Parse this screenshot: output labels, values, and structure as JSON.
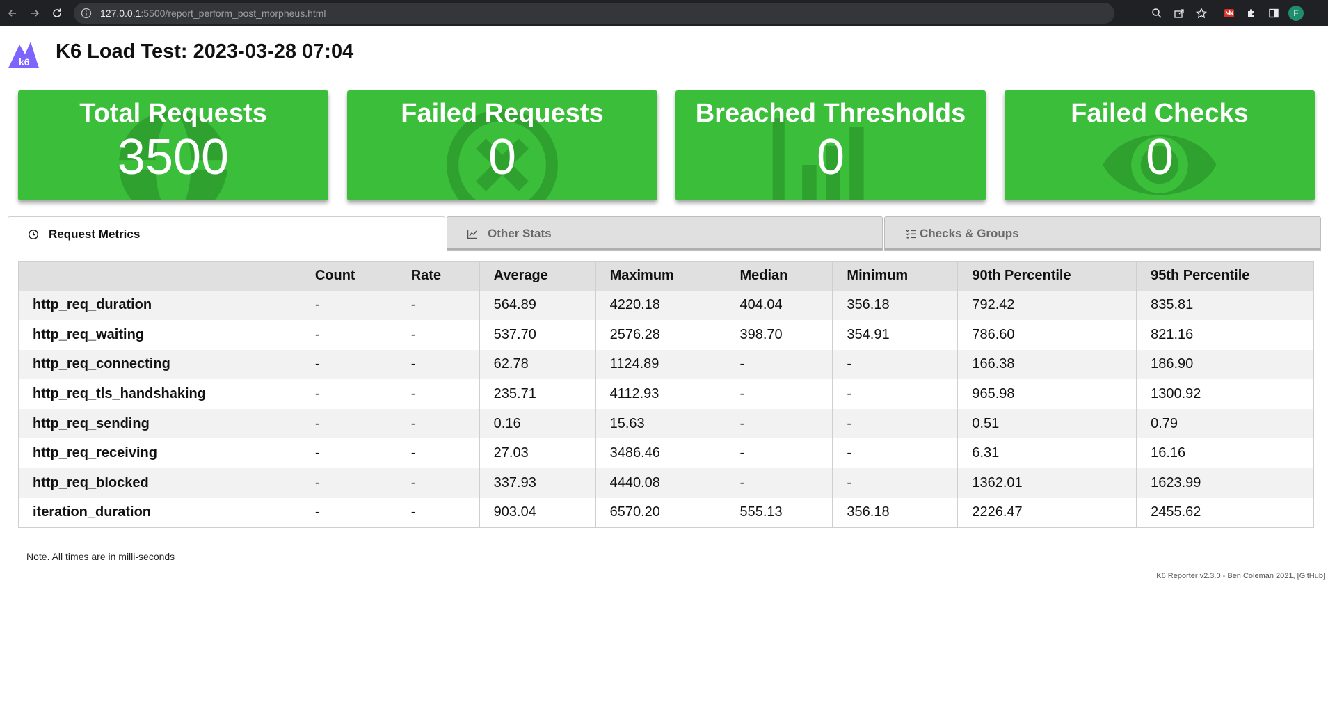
{
  "browser": {
    "url_host": "127.0.0.1",
    "url_path": ":5500/report_perform_post_morpheus.html",
    "profile_initial": "F"
  },
  "header": {
    "logo_text": "k6",
    "title": "K6 Load Test: 2023-03-28 07:04"
  },
  "cards": [
    {
      "title": "Total Requests",
      "value": "3500",
      "icon": "globe-icon"
    },
    {
      "title": "Failed Requests",
      "value": "0",
      "icon": "times-circle-icon"
    },
    {
      "title": "Breached Thresholds",
      "value": "0",
      "icon": "bar-chart-icon"
    },
    {
      "title": "Failed Checks",
      "value": "0",
      "icon": "eye-icon"
    }
  ],
  "colors": {
    "card_green": "#3bbf3b",
    "card_icon": "#2fa12f"
  },
  "tabs": [
    {
      "label": "Request Metrics",
      "icon": "clock-icon",
      "active": true
    },
    {
      "label": "Other Stats",
      "icon": "line-chart-icon",
      "active": false
    },
    {
      "label": "Checks & Groups",
      "icon": "checklist-icon",
      "active": false
    }
  ],
  "table": {
    "headers": [
      "",
      "Count",
      "Rate",
      "Average",
      "Maximum",
      "Median",
      "Minimum",
      "90th Percentile",
      "95th Percentile"
    ],
    "rows": [
      [
        "http_req_duration",
        "-",
        "-",
        "564.89",
        "4220.18",
        "404.04",
        "356.18",
        "792.42",
        "835.81"
      ],
      [
        "http_req_waiting",
        "-",
        "-",
        "537.70",
        "2576.28",
        "398.70",
        "354.91",
        "786.60",
        "821.16"
      ],
      [
        "http_req_connecting",
        "-",
        "-",
        "62.78",
        "1124.89",
        "-",
        "-",
        "166.38",
        "186.90"
      ],
      [
        "http_req_tls_handshaking",
        "-",
        "-",
        "235.71",
        "4112.93",
        "-",
        "-",
        "965.98",
        "1300.92"
      ],
      [
        "http_req_sending",
        "-",
        "-",
        "0.16",
        "15.63",
        "-",
        "-",
        "0.51",
        "0.79"
      ],
      [
        "http_req_receiving",
        "-",
        "-",
        "27.03",
        "3486.46",
        "-",
        "-",
        "6.31",
        "16.16"
      ],
      [
        "http_req_blocked",
        "-",
        "-",
        "337.93",
        "4440.08",
        "-",
        "-",
        "1362.01",
        "1623.99"
      ],
      [
        "iteration_duration",
        "-",
        "-",
        "903.04",
        "6570.20",
        "555.13",
        "356.18",
        "2226.47",
        "2455.62"
      ]
    ]
  },
  "note": "Note. All times are in milli-seconds",
  "footer": "K6 Reporter v2.3.0 - Ben Coleman 2021, [GitHub]"
}
